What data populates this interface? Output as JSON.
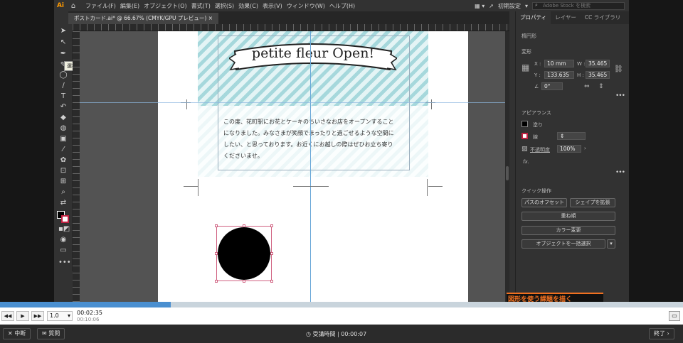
{
  "app": {
    "logo": "Ai",
    "home_icon": "home-icon"
  },
  "menubar": {
    "items": [
      "ファイル(F)",
      "編集(E)",
      "オブジェクト(O)",
      "書式(T)",
      "選択(S)",
      "効果(C)",
      "表示(V)",
      "ウィンドウ(W)",
      "ヘルプ(H)"
    ],
    "workspace": "初期設定",
    "stock_placeholder": "Adobe Stock を検索"
  },
  "document": {
    "tab": "ポストカード.ai* @ 66.67% (CMYK/GPU プレビュー)"
  },
  "toolbar": {
    "tooltip": "選択ツール (V)"
  },
  "artwork": {
    "title": "petite fleur Open!",
    "body": [
      "この度、花町駅にお花とケーキのちいさなお店をオープンすること",
      "になりました。みなさまが笑顔でまったりと過ごせるような空間に",
      "したい、と思っております。お近くにお越しの際はぜひお立ち寄り",
      "くださいませ。"
    ]
  },
  "panel": {
    "tabs": [
      "プロパティ",
      "レイヤー",
      "CC ライブラリ"
    ],
    "section_selected": "楕円形",
    "section_transform": "変形",
    "x_label": "X :",
    "x_value": "10 mm",
    "y_label": "Y :",
    "y_value": "133.635",
    "w_label": "W :",
    "w_value": "35.465 r",
    "h_label": "H :",
    "h_value": "35.465 r",
    "angle": "0°",
    "section_appearance": "アピアランス",
    "fill_label": "塗り",
    "stroke_label": "線",
    "opacity_label": "不透明度",
    "opacity_value": "100%",
    "fx": "fx.",
    "section_quick": "クイック操作",
    "btn_offset": "パスのオフセット",
    "btn_expand": "シェイプを拡張",
    "btn_arrange": "重ね順",
    "btn_recolor": "カラー変更",
    "btn_select_same": "オブジェクトを一括選択"
  },
  "overlay": {
    "orange_text": "図形を使う課題を描く"
  },
  "player": {
    "current_time": "00:02:35",
    "total_time": "00:10:06",
    "speed": "1.0",
    "progress": 0.25
  },
  "bottom": {
    "suspend": "中断",
    "question": "質問",
    "elapsed_label": "受講時間 | 00:00:07",
    "end": "終了"
  }
}
